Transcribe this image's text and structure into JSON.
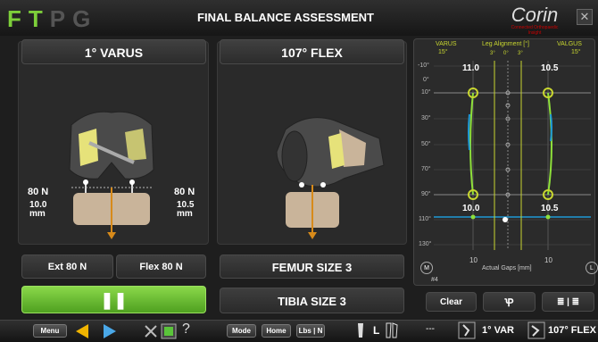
{
  "header": {
    "logo_letters": [
      "F",
      "T",
      "P",
      "G"
    ],
    "title": "FINAL BALANCE ASSESSMENT",
    "brand": "Corin",
    "brand_tagline": "Connected Orthopaedic Insight",
    "close_glyph": "✕"
  },
  "left": {
    "varus_label": "1° VARUS",
    "medial_force": "80 N",
    "lateral_force": "80 N",
    "medial_gap": "10.0",
    "lateral_gap": "10.5",
    "gap_unit": "mm",
    "ext_button": "Ext 80 N",
    "flex_button": "Flex 80 N"
  },
  "middle": {
    "flex_label": "107° FLEX",
    "femur_size": "FEMUR SIZE 3",
    "tibia_size": "TIBIA SIZE 3"
  },
  "graph": {
    "varus": "VARUS",
    "valgus": "VALGUS",
    "varus_deg": "15°",
    "valgus_deg": "15°",
    "title": "Leg Alignment [°]",
    "deg_ticks": [
      "3°",
      "0°",
      "3°"
    ],
    "top_left_value": "11.0",
    "top_right_value": "10.5",
    "bottom_left_value": "10.0",
    "bottom_right_value": "10.5",
    "y_labels": [
      "-10°",
      "0°",
      "10°",
      "30°",
      "50°",
      "70°",
      "90°",
      "110°",
      "130°"
    ],
    "x_left": "10",
    "x_right": "10",
    "x_title": "Actual Gaps [mm]",
    "m_label": "M",
    "l_label": "L",
    "id_label": "#4"
  },
  "controls": {
    "clear": "Clear",
    "pause_glyph": "❚❚",
    "list_glyph": "≣ | ≣"
  },
  "bottom": {
    "menu": "Menu",
    "mode": "Mode",
    "home": "Home",
    "units": "Lbs | N",
    "side": "L",
    "help": "?",
    "dashes": "---",
    "varus_status": "1° VAR",
    "flex_status": "107° FLEX"
  },
  "colors": {
    "accent_green": "#7dcf3a",
    "line_blue": "#1e9ad6",
    "yellow": "#c8d630"
  }
}
